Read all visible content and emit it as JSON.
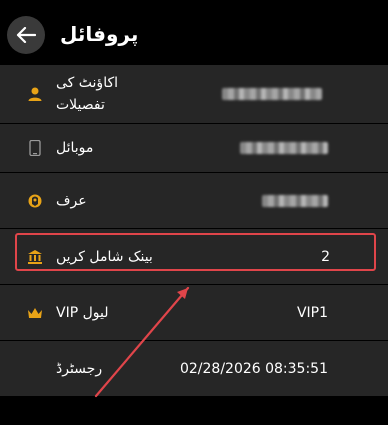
{
  "header": {
    "title": "پروفائل",
    "back_icon": "arrow-left-icon"
  },
  "rows": [
    {
      "label": "اکاؤنٹ کی\nتفصیلات",
      "icon": "user-icon",
      "value": ""
    },
    {
      "label": "موبائل",
      "icon": "phone-icon",
      "value": ""
    },
    {
      "label": "عرف",
      "icon": "nickname-icon",
      "value": ""
    },
    {
      "label": "بینک شامل کریں",
      "icon": "bank-icon",
      "value": "2"
    },
    {
      "label": "لیول VIP",
      "icon": "crown-icon",
      "value": "VIP1"
    },
    {
      "label": "رجسٹرڈ",
      "icon": "",
      "value": "02/28/2026 08:35:51"
    }
  ],
  "colors": {
    "accent": "#e8a317",
    "row_bg": "#262626",
    "annotation": "#e0454a"
  }
}
